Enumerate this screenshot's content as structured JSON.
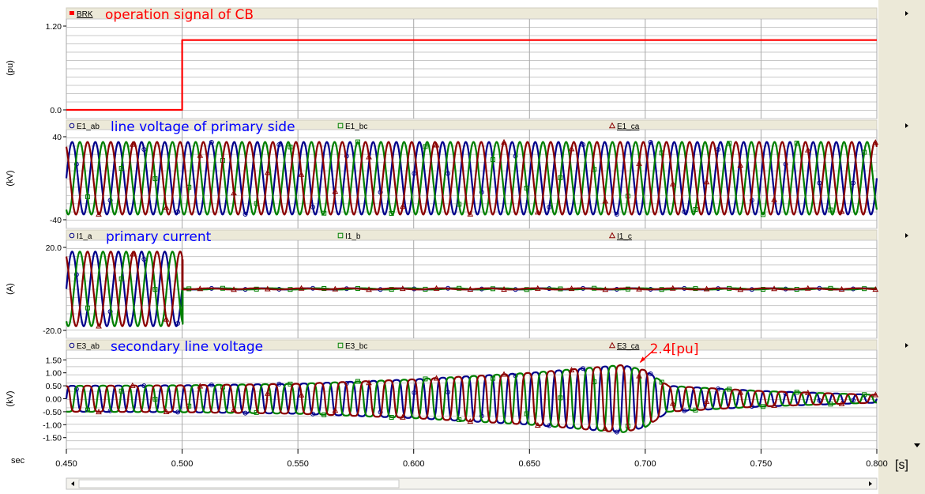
{
  "colors": {
    "red": "#ff0000",
    "blue": "#00008b",
    "green": "#008000",
    "maroon": "#8b0000",
    "annot_blue": "#0000ff",
    "annot_red": "#ff0000",
    "panel_bg": "#ffffff",
    "frame_bg": "#ece9d8",
    "grid": "#a0a0a0"
  },
  "x_axis": {
    "unit_label": "sec",
    "unit_bracket": "[s]",
    "range": [
      0.45,
      0.8
    ],
    "ticks": [
      0.45,
      0.5,
      0.55,
      0.6,
      0.65,
      0.7,
      0.75,
      0.8
    ],
    "tick_labels": [
      "0.450",
      "0.500",
      "0.550",
      "0.600",
      "0.650",
      "0.700",
      "0.750",
      "0.800"
    ]
  },
  "chart_data": [
    {
      "type": "line",
      "name": "brk",
      "ylabel": "(pu)",
      "ylim": [
        0,
        1.2
      ],
      "yticks": [
        0,
        1.2
      ],
      "ytick_labels": [
        "0.0",
        "1.20"
      ],
      "annotation": "operation signal  of  CB",
      "legend": [
        {
          "name": "BRK",
          "color": "#ff0000",
          "marker": "square"
        }
      ],
      "series": [
        {
          "name": "BRK",
          "color": "#ff0000",
          "kind": "step",
          "x": [
            0.45,
            0.5,
            0.5,
            0.8
          ],
          "y": [
            0,
            0,
            1.0,
            1.0
          ]
        }
      ]
    },
    {
      "type": "line",
      "name": "e1",
      "ylabel": "(kV)",
      "ylim": [
        -40,
        40
      ],
      "yticks": [
        -40,
        40
      ],
      "ytick_labels": [
        "-40",
        "40"
      ],
      "annotation": "line  voltage  of  primary  side",
      "legend": [
        {
          "name": "E1_ab",
          "color": "#00008b",
          "marker": "circle"
        },
        {
          "name": "E1_bc",
          "color": "#008000",
          "marker": "square"
        },
        {
          "name": "E1_ca",
          "color": "#8b0000",
          "marker": "triangle"
        }
      ],
      "series": [
        {
          "name": "E1_ab",
          "color": "#00008b",
          "kind": "sine",
          "amplitude": 35,
          "frequency_hz": 100,
          "phase_deg": 0
        },
        {
          "name": "E1_bc",
          "color": "#008000",
          "kind": "sine",
          "amplitude": 35,
          "frequency_hz": 100,
          "phase_deg": -120
        },
        {
          "name": "E1_ca",
          "color": "#8b0000",
          "kind": "sine",
          "amplitude": 35,
          "frequency_hz": 100,
          "phase_deg": 120
        }
      ]
    },
    {
      "type": "line",
      "name": "i1",
      "ylabel": "(A)",
      "ylim": [
        -20,
        20
      ],
      "yticks": [
        -20,
        20
      ],
      "ytick_labels": [
        "-20.0",
        "20.0"
      ],
      "annotation": "primary  current",
      "legend": [
        {
          "name": "I1_a",
          "color": "#00008b",
          "marker": "circle"
        },
        {
          "name": "I1_b",
          "color": "#008000",
          "marker": "square"
        },
        {
          "name": "I1_c",
          "color": "#8b0000",
          "marker": "triangle"
        }
      ],
      "series": [
        {
          "name": "I1_a",
          "color": "#00008b",
          "kind": "sine_cut",
          "amplitude": 18,
          "frequency_hz": 100,
          "phase_deg": 0,
          "cut_x": 0.5,
          "after_value": 0
        },
        {
          "name": "I1_b",
          "color": "#008000",
          "kind": "sine_cut",
          "amplitude": 18,
          "frequency_hz": 100,
          "phase_deg": -120,
          "cut_x": 0.5,
          "after_value": 0
        },
        {
          "name": "I1_c",
          "color": "#8b0000",
          "kind": "sine_cut",
          "amplitude": 18,
          "frequency_hz": 100,
          "phase_deg": 120,
          "cut_x": 0.5,
          "after_value": 0
        }
      ]
    },
    {
      "type": "line",
      "name": "e3",
      "ylabel": "(kV)",
      "ylim": [
        -1.6,
        1.6
      ],
      "yticks": [
        -1.5,
        -1.0,
        -0.5,
        0.0,
        0.5,
        1.0,
        1.5
      ],
      "ytick_labels": [
        "-1.50",
        "-1.00",
        "-0.50",
        "0.00",
        "0.50",
        "1.00",
        "1.50"
      ],
      "annotation": "secondary  line  voltage",
      "peak_annotation": {
        "text": "2.4[pu]",
        "x": 0.6965,
        "y": 1.32
      },
      "legend": [
        {
          "name": "E3_ab",
          "color": "#00008b",
          "marker": "circle"
        },
        {
          "name": "E3_bc",
          "color": "#008000",
          "marker": "square"
        },
        {
          "name": "E3_ca",
          "color": "#8b0000",
          "marker": "triangle"
        }
      ],
      "envelope": {
        "x": [
          0.45,
          0.5,
          0.55,
          0.6,
          0.65,
          0.69,
          0.7,
          0.71,
          0.75,
          0.8
        ],
        "amp": [
          0.5,
          0.52,
          0.58,
          0.75,
          1.0,
          1.3,
          1.1,
          0.5,
          0.3,
          0.15
        ]
      },
      "series": [
        {
          "name": "E3_ab",
          "color": "#00008b",
          "kind": "ferro",
          "frequency_hz": 100,
          "phase_deg": 0
        },
        {
          "name": "E3_bc",
          "color": "#008000",
          "kind": "ferro",
          "frequency_hz": 100,
          "phase_deg": -120
        },
        {
          "name": "E3_ca",
          "color": "#8b0000",
          "kind": "ferro",
          "frequency_hz": 100,
          "phase_deg": 120
        }
      ]
    }
  ]
}
